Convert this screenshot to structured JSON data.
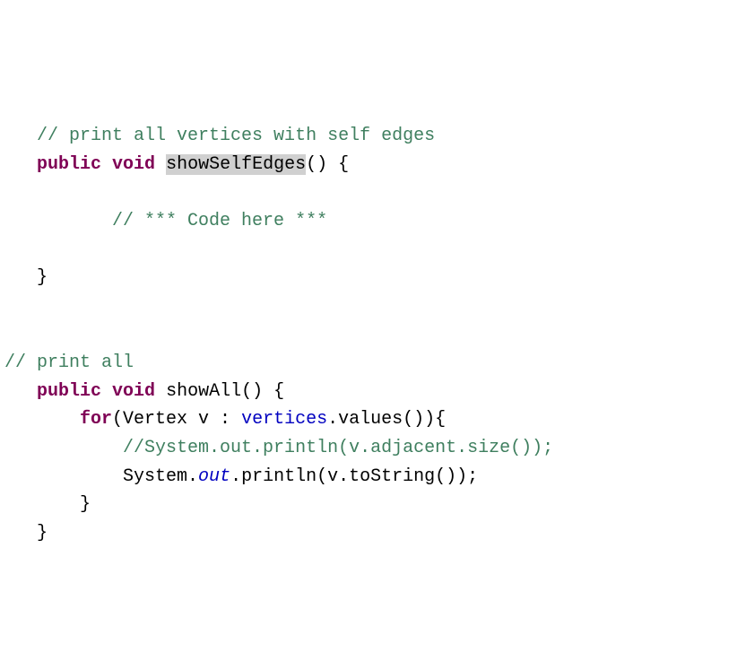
{
  "code": {
    "line1_comment": "// print all vertices with self edges",
    "line2_keyword1": "public",
    "line2_keyword2": "void",
    "line2_method_hl": "showSelfEdges",
    "line2_rest": "() {",
    "line3_comment": "// *** Code here ***",
    "line4_close": "}",
    "line5_comment": "// print all",
    "line6_keyword1": "public",
    "line6_keyword2": "void",
    "line6_method": "showAll() {",
    "line7_keyword": "for",
    "line7_p1": "(Vertex v : ",
    "line7_field": "vertices",
    "line7_p2": ".values()){",
    "line8_comment": "//System.out.println(v.adjacent.size());",
    "line9_p1": "System.",
    "line9_static": "out",
    "line9_p2": ".println(v.toString());",
    "line10_close": "}",
    "line11_close": "}"
  }
}
